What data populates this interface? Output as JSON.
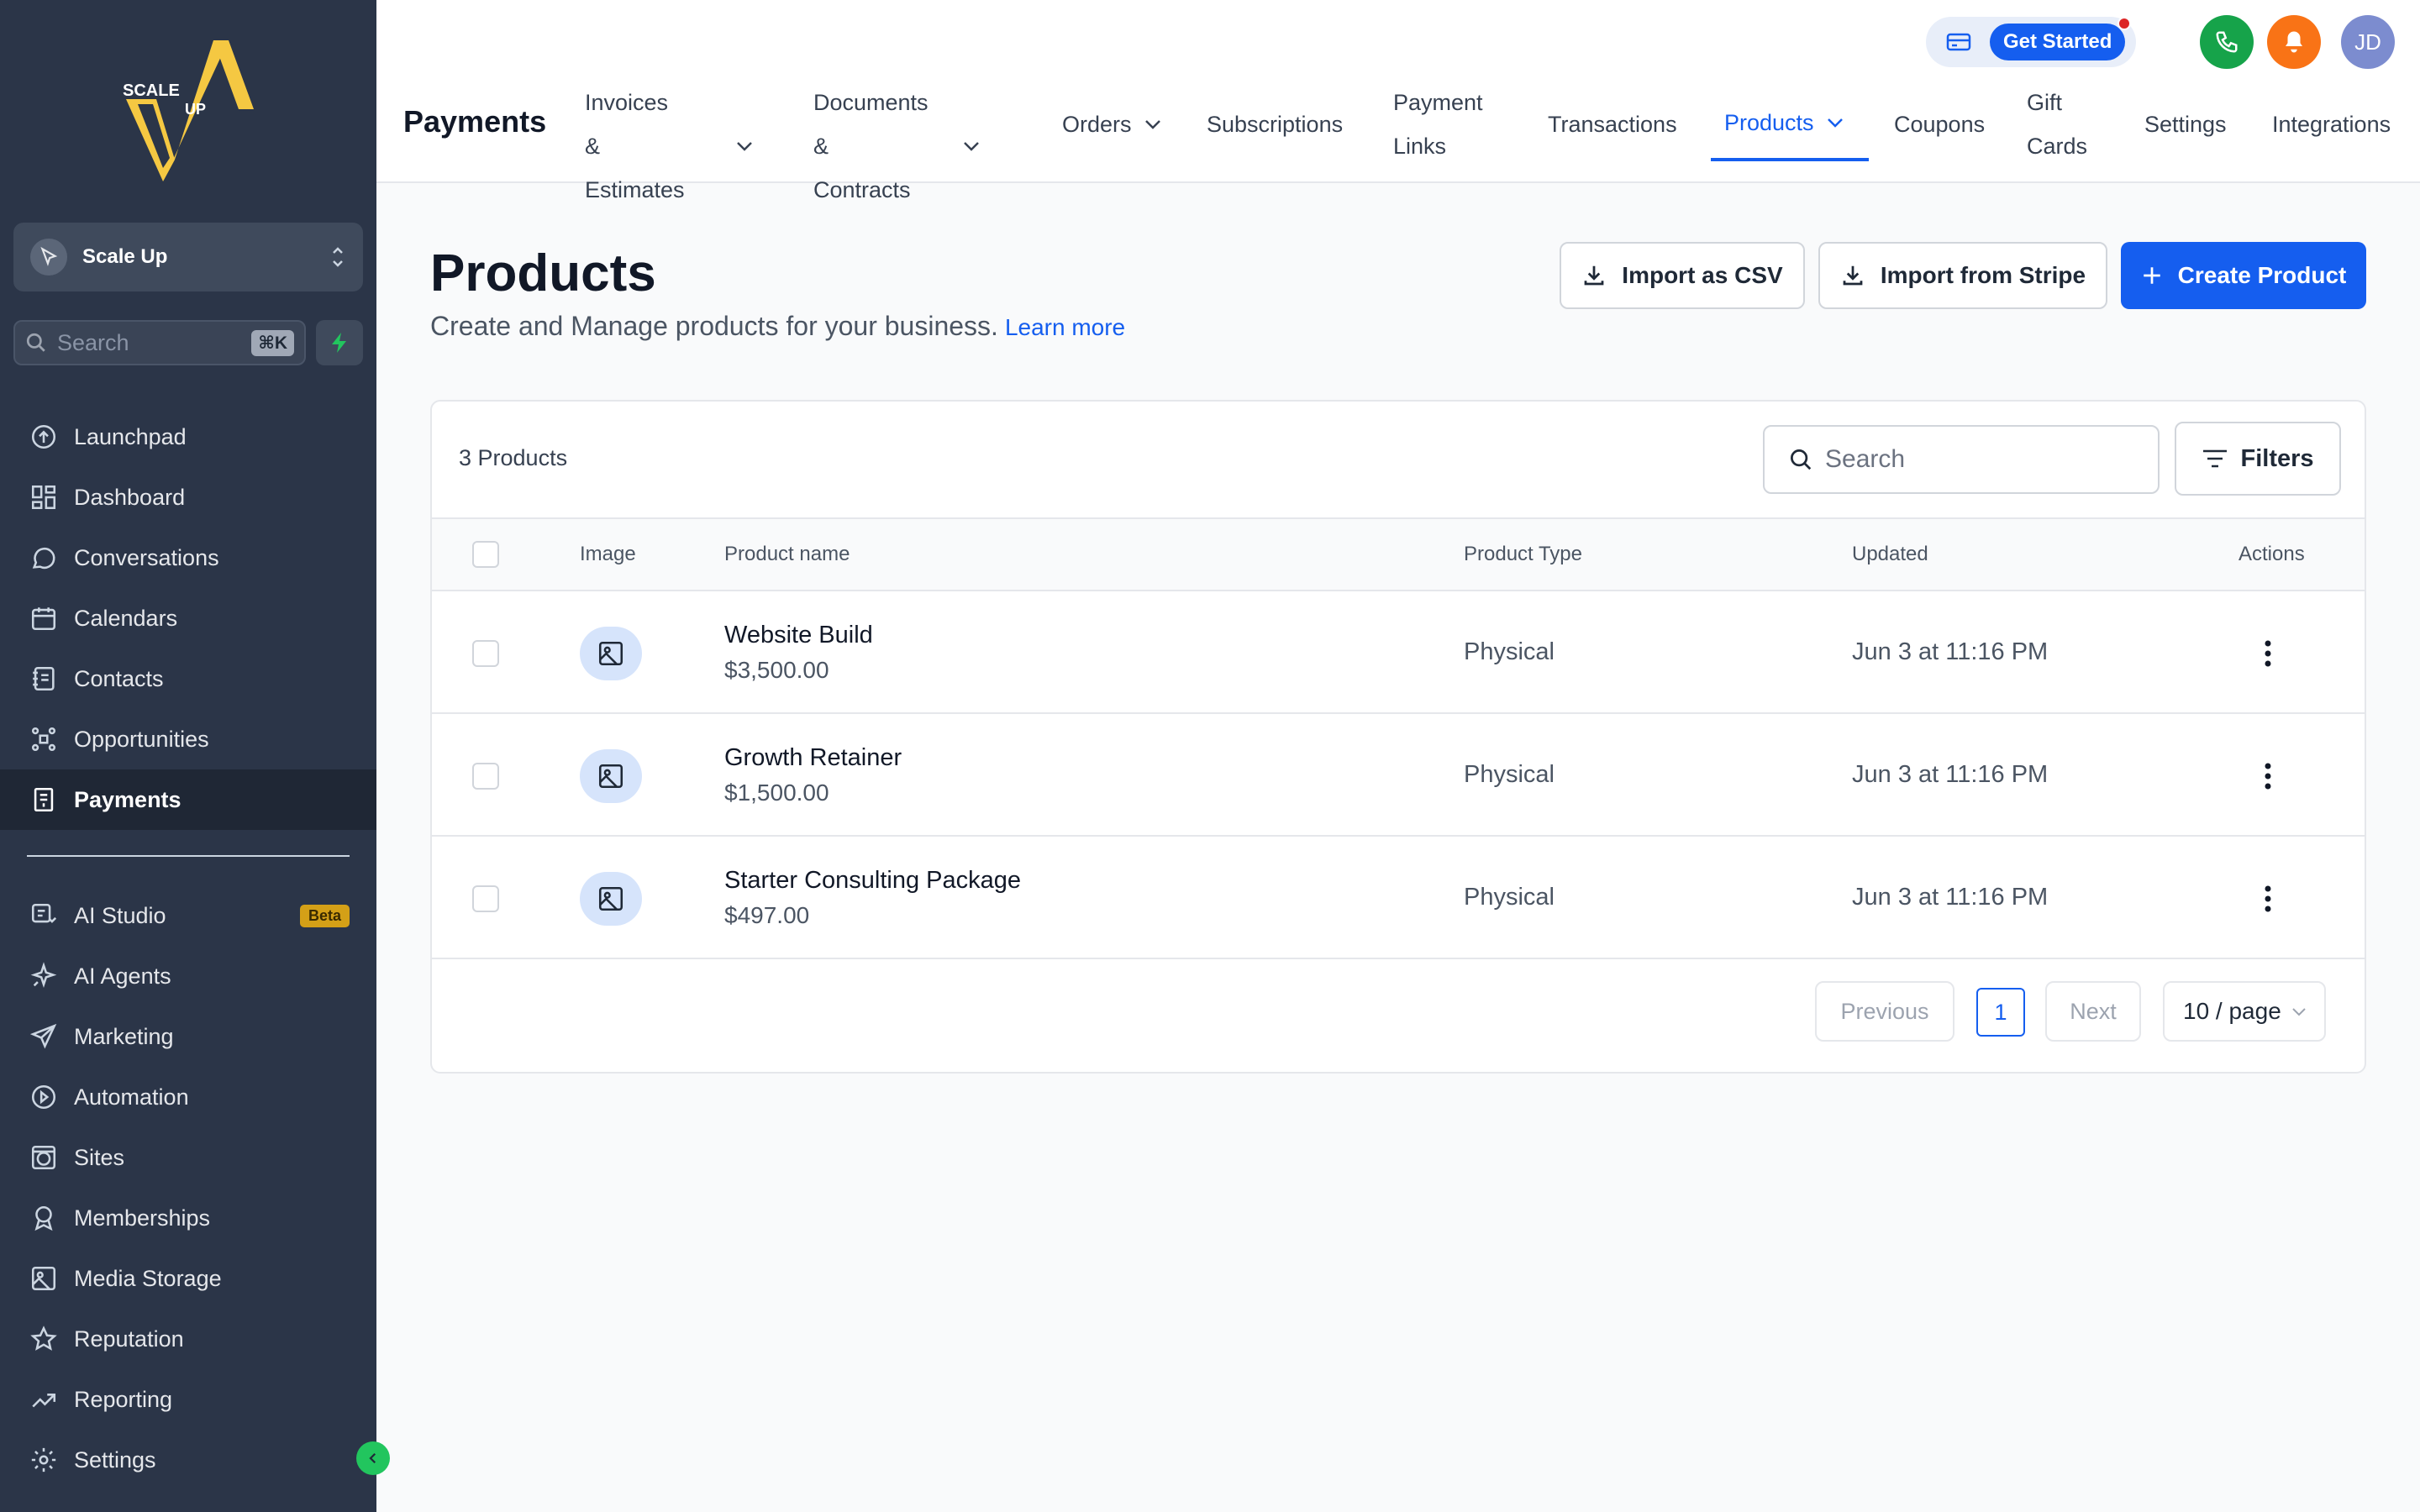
{
  "brand": {
    "logo_text_1": "SCALE",
    "logo_text_2": "UP",
    "accent": "#f5c842"
  },
  "sidebar": {
    "account_name": "Scale Up",
    "search_placeholder": "Search",
    "search_shortcut": "⌘K",
    "items": [
      {
        "label": "Launchpad",
        "icon": "rocket-icon"
      },
      {
        "label": "Dashboard",
        "icon": "grid-icon"
      },
      {
        "label": "Conversations",
        "icon": "chat-icon"
      },
      {
        "label": "Calendars",
        "icon": "calendar-icon"
      },
      {
        "label": "Contacts",
        "icon": "contacts-icon"
      },
      {
        "label": "Opportunities",
        "icon": "funnel-icon"
      },
      {
        "label": "Payments",
        "icon": "receipt-icon",
        "active": true
      }
    ],
    "items2": [
      {
        "label": "AI Studio",
        "icon": "ai-studio-icon",
        "badge": "Beta"
      },
      {
        "label": "AI Agents",
        "icon": "sparkle-icon"
      },
      {
        "label": "Marketing",
        "icon": "send-icon"
      },
      {
        "label": "Automation",
        "icon": "automation-icon"
      },
      {
        "label": "Sites",
        "icon": "globe-icon"
      },
      {
        "label": "Memberships",
        "icon": "badge-icon"
      },
      {
        "label": "Media Storage",
        "icon": "image-icon"
      },
      {
        "label": "Reputation",
        "icon": "star-icon"
      },
      {
        "label": "Reporting",
        "icon": "trend-icon"
      },
      {
        "label": "Settings",
        "icon": "gear-icon"
      }
    ]
  },
  "header": {
    "get_started": "Get Started",
    "user_initials": "JD",
    "page_name": "Payments",
    "tabs": [
      {
        "l1": "Invoices &",
        "l2": "Estimates",
        "dropdown": true
      },
      {
        "l1": "Documents &",
        "l2": "Contracts",
        "dropdown": true
      },
      {
        "l1": "Orders",
        "dropdown": true
      },
      {
        "l1": "Subscriptions"
      },
      {
        "l1": "Payment",
        "l2": "Links"
      },
      {
        "l1": "Transactions"
      },
      {
        "l1": "Products",
        "dropdown": true,
        "active": true
      },
      {
        "l1": "Coupons"
      },
      {
        "l1": "Gift",
        "l2": "Cards"
      },
      {
        "l1": "Settings"
      },
      {
        "l1": "Integrations"
      }
    ]
  },
  "main": {
    "title": "Products",
    "subtitle": "Create and Manage products for your business.",
    "learn_more": "Learn more",
    "import_csv": "Import as CSV",
    "import_stripe": "Import from Stripe",
    "create": "Create Product"
  },
  "table": {
    "count": "3 Products",
    "search_placeholder": "Search",
    "filters": "Filters",
    "columns": [
      "Image",
      "Product name",
      "Product Type",
      "Updated",
      "Actions"
    ],
    "rows": [
      {
        "name": "Website Build",
        "price": "$3,500.00",
        "type": "Physical",
        "updated": "Jun 3 at 11:16 PM"
      },
      {
        "name": "Growth Retainer",
        "price": "$1,500.00",
        "type": "Physical",
        "updated": "Jun 3 at 11:16 PM"
      },
      {
        "name": "Starter Consulting Package",
        "price": "$497.00",
        "type": "Physical",
        "updated": "Jun 3 at 11:16 PM"
      }
    ]
  },
  "pagination": {
    "previous": "Previous",
    "page": "1",
    "next": "Next",
    "per_page": "10 / page"
  }
}
